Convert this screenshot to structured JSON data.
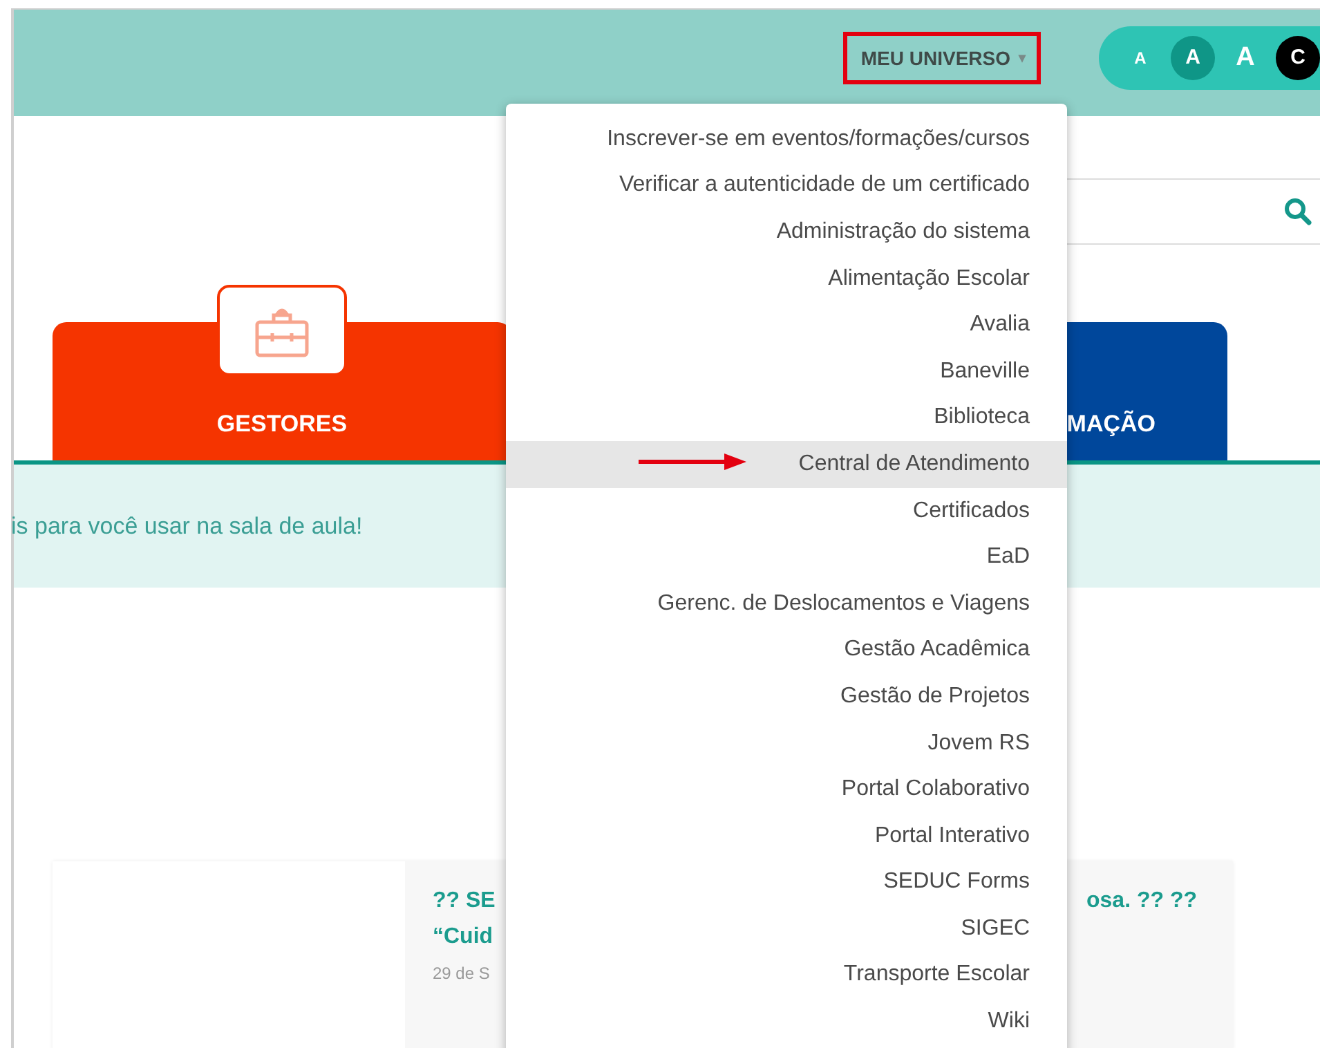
{
  "header": {
    "menu_button": {
      "label": "MEU UNIVERSO",
      "caret": "▾",
      "highlighted": true
    },
    "font_size_buttons": [
      {
        "label": "A",
        "kind": "small",
        "selected": false
      },
      {
        "label": "A",
        "kind": "medium",
        "selected": true
      },
      {
        "label": "A",
        "kind": "large",
        "selected": false
      },
      {
        "label": "C",
        "kind": "contrast",
        "selected": false
      }
    ]
  },
  "tabs": [
    {
      "label": "GESTORES",
      "kind": "gestores",
      "selected": false
    },
    {
      "label": "MAÇÃO",
      "kind": "formacao",
      "selected": false
    }
  ],
  "banner": {
    "text": "is para você usar na sala de aula!"
  },
  "card": {
    "title_left": "?? SE",
    "title_right": "osa. ?? ??",
    "title_line2": "“Cuid",
    "date": "29 de S"
  },
  "dropdown": {
    "items": [
      {
        "label": "Inscrever-se em eventos/formações/cursos",
        "selected": false,
        "marked": false
      },
      {
        "label": "Verificar a autenticidade de um certificado",
        "selected": false,
        "marked": false
      },
      {
        "label": "Administração do sistema",
        "selected": false,
        "marked": false
      },
      {
        "label": "Alimentação Escolar",
        "selected": false,
        "marked": false
      },
      {
        "label": "Avalia",
        "selected": false,
        "marked": false
      },
      {
        "label": "Baneville",
        "selected": false,
        "marked": false
      },
      {
        "label": "Biblioteca",
        "selected": false,
        "marked": false
      },
      {
        "label": "Central de Atendimento",
        "selected": true,
        "marked": true
      },
      {
        "label": "Certificados",
        "selected": false,
        "marked": false
      },
      {
        "label": "EaD",
        "selected": false,
        "marked": false
      },
      {
        "label": "Gerenc. de Deslocamentos e Viagens",
        "selected": false,
        "marked": false
      },
      {
        "label": "Gestão Acadêmica",
        "selected": false,
        "marked": false
      },
      {
        "label": "Gestão de Projetos",
        "selected": false,
        "marked": false
      },
      {
        "label": "Jovem RS",
        "selected": false,
        "marked": false
      },
      {
        "label": "Portal Colaborativo",
        "selected": false,
        "marked": false
      },
      {
        "label": "Portal Interativo",
        "selected": false,
        "marked": false
      },
      {
        "label": "SEDUC Forms",
        "selected": false,
        "marked": false
      },
      {
        "label": "SIGEC",
        "selected": false,
        "marked": false
      },
      {
        "label": "Transporte Escolar",
        "selected": false,
        "marked": false
      },
      {
        "label": "Wiki",
        "selected": false,
        "marked": false
      }
    ]
  }
}
